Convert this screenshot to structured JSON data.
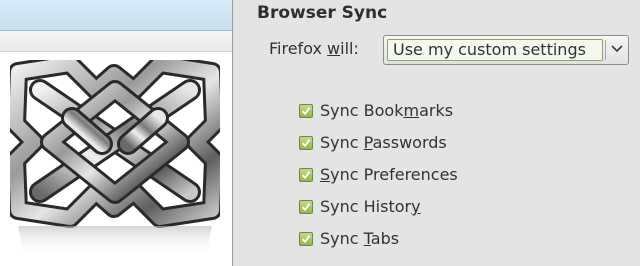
{
  "sync": {
    "title": "Browser Sync",
    "firefox_will_label": "Firefox will:",
    "setting_value": "Use my custom settings",
    "options": [
      {
        "label": "Sync Bookmarks",
        "checked": true
      },
      {
        "label": "Sync Passwords",
        "checked": true
      },
      {
        "label": "Sync Preferences",
        "checked": true
      },
      {
        "label": "Sync History",
        "checked": true
      },
      {
        "label": "Sync Tabs",
        "checked": true
      }
    ]
  },
  "icons": {
    "preview": "celtic-knot-logo",
    "dropdown": "chevron-down-icon",
    "checkbox": "check-icon"
  },
  "colors": {
    "checkbox_fill": "#a8c65f",
    "checkbox_border": "#6f8a3a",
    "combo_focus": "#8ea35f",
    "window_bg": "#e4e4e4"
  }
}
